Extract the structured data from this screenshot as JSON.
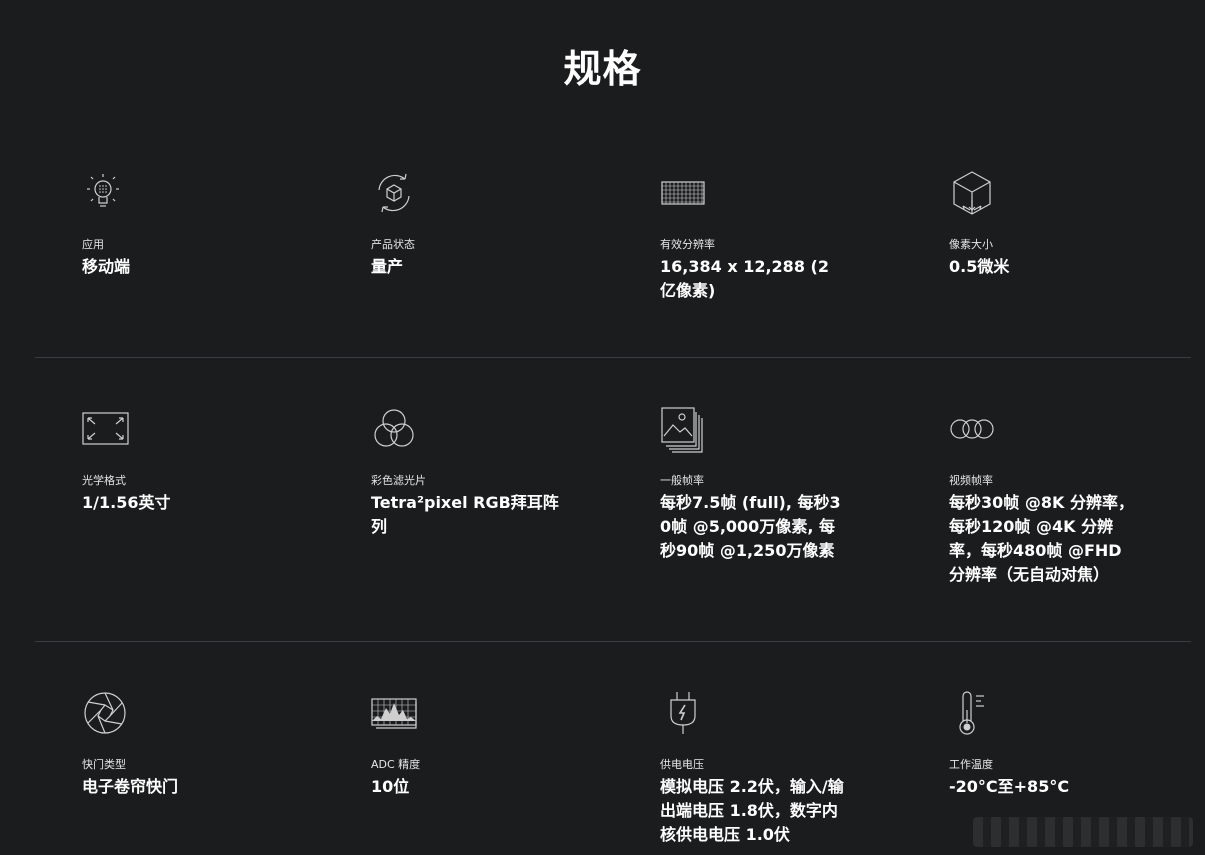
{
  "page": {
    "title": "规格"
  },
  "specs": [
    {
      "icon": "light-bulb-icon",
      "label": "应用",
      "value": "移动端"
    },
    {
      "icon": "cube-rotate-icon",
      "label": "产品状态",
      "value": "量产"
    },
    {
      "icon": "pixel-grid-icon",
      "label": "有效分辨率",
      "value": "16,384 x 12,288 (2亿像素)"
    },
    {
      "icon": "pixel-cube-icon",
      "label": "像素大小",
      "value": "0.5微米"
    },
    {
      "icon": "expand-frame-icon",
      "label": "光学格式",
      "value": "1/1.56英寸"
    },
    {
      "icon": "rgb-circles-icon",
      "label": "彩色滤光片",
      "value": "Tetra²pixel RGB拜耳阵列"
    },
    {
      "icon": "image-stack-icon",
      "label": "一般帧率",
      "value": "每秒7.5帧 (full), 每秒30帧 @5,000万像素, 每秒90帧 @1,250万像素"
    },
    {
      "icon": "video-circles-icon",
      "label": "视频帧率",
      "value": "每秒30帧 @8K 分辨率，每秒120帧 @4K 分辨率，每秒480帧 @FHD 分辨率（无自动对焦）"
    },
    {
      "icon": "shutter-aperture-icon",
      "label": "快门类型",
      "value": "电子卷帘快门"
    },
    {
      "icon": "adc-waveform-icon",
      "label": "ADC 精度",
      "value": "10位"
    },
    {
      "icon": "power-plug-icon",
      "label": "供电电压",
      "value": "模拟电压 2.2伏，输入/输出端电压 1.8伏，数字内核供电电压 1.0伏"
    },
    {
      "icon": "thermometer-icon",
      "label": "工作温度",
      "value": "-20°C至+85°C"
    }
  ],
  "colors": {
    "background": "#1b1c1e",
    "text": "#ffffff",
    "divider": "#3c3d40",
    "icon_stroke": "#cfcfcf"
  }
}
